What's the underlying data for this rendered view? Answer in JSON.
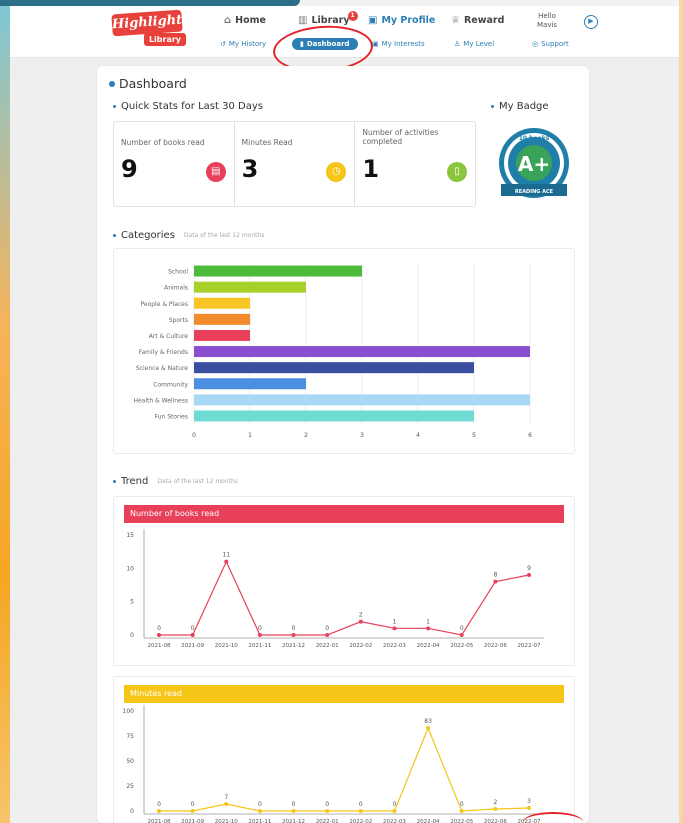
{
  "header": {
    "logo_main": "Highlights",
    "logo_sub": "Library",
    "nav": [
      {
        "label": "Home",
        "icon": "home-icon"
      },
      {
        "label": "Library",
        "icon": "library-icon",
        "badge": "1"
      },
      {
        "label": "My Profile",
        "icon": "profile-icon"
      },
      {
        "label": "Reward",
        "icon": "trophy-icon"
      }
    ],
    "hello_line1": "Hello",
    "hello_line2": "Mavis",
    "subnav": [
      {
        "label": "My History",
        "icon": "history-icon"
      },
      {
        "label": "Dashboard",
        "icon": "chart-icon"
      },
      {
        "label": "My Interests",
        "icon": "interests-icon"
      },
      {
        "label": "My Level",
        "icon": "level-icon"
      },
      {
        "label": "Support",
        "icon": "support-icon"
      }
    ]
  },
  "dashboard": {
    "title": "Dashboard",
    "quick_stats_title": "Quick Stats for Last 30 Days",
    "stats": [
      {
        "label": "Number of books read",
        "value": "9",
        "icon": "book-icon",
        "color": "#e8405a"
      },
      {
        "label": "Minutes Read",
        "value": "3",
        "icon": "clock-icon",
        "color": "#f5c518"
      },
      {
        "label": "Number of activities completed",
        "value": "1",
        "icon": "activity-icon",
        "color": "#8cc63f"
      }
    ],
    "badge_title": "My Badge",
    "badge": {
      "top_text": "10 books",
      "grade": "A+",
      "ribbon": "READING ACE"
    },
    "categories_title": "Categories",
    "categories_sub": "Data of the last 12 months",
    "trend_title": "Trend",
    "trend_sub": "Data of the last 12 months"
  },
  "chart_data": [
    {
      "type": "bar",
      "orientation": "horizontal",
      "categories": [
        "School",
        "Animals",
        "People & Places",
        "Sports",
        "Art & Culture",
        "Family & Friends",
        "Science & Nature",
        "Community",
        "Health & Wellness",
        "Fun Stories"
      ],
      "values": [
        3,
        2,
        1,
        1,
        1,
        6,
        5,
        2,
        6,
        5
      ],
      "colors": [
        "#4cbb3a",
        "#a6d12a",
        "#f7c525",
        "#f08a2a",
        "#e8405a",
        "#8a4fd0",
        "#3a4fa0",
        "#4a8fe0",
        "#a7d8f5",
        "#6fdcd4"
      ],
      "xlim": [
        0,
        6
      ],
      "xticks": [
        "0",
        "1",
        "2",
        "3",
        "4",
        "5",
        "6"
      ],
      "grid": true
    },
    {
      "type": "line",
      "title": "Number of books read",
      "color": "#e8405a",
      "x": [
        "2021-08",
        "2021-09",
        "2021-10",
        "2021-11",
        "2021-12",
        "2022-01",
        "2022-02",
        "2022-03",
        "2022-04",
        "2022-05",
        "2022-06",
        "2022-07"
      ],
      "values": [
        0,
        0,
        11,
        0,
        0,
        0,
        2,
        1,
        1,
        0,
        8,
        9
      ],
      "ylim": [
        0,
        15
      ],
      "yticks": [
        "0",
        "5",
        "10",
        "15"
      ]
    },
    {
      "type": "line",
      "title": "Minutes read",
      "color": "#f5c518",
      "x": [
        "2021-08",
        "2021-09",
        "2021-10",
        "2021-11",
        "2021-12",
        "2022-01",
        "2022-02",
        "2022-03",
        "2022-04",
        "2022-05",
        "2022-06",
        "2022-07"
      ],
      "values": [
        0,
        0,
        7,
        0,
        0,
        0,
        0,
        0,
        83,
        0,
        2,
        3
      ],
      "ylim": [
        0,
        100
      ],
      "yticks": [
        "0",
        "25",
        "50",
        "75",
        "100"
      ]
    }
  ]
}
